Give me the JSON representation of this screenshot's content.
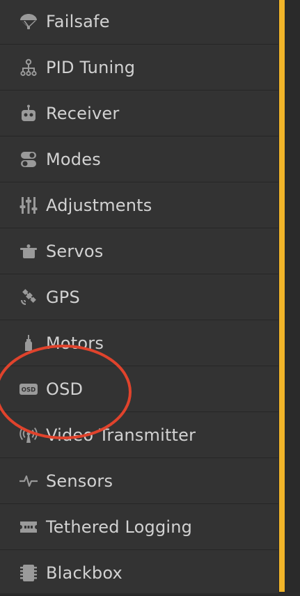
{
  "accent_color": "#f0b429",
  "annotation_color": "#e0432c",
  "sidebar": {
    "items": [
      {
        "label": "Failsafe",
        "icon": "parachute-icon"
      },
      {
        "label": "PID Tuning",
        "icon": "sitemap-icon"
      },
      {
        "label": "Receiver",
        "icon": "robot-icon"
      },
      {
        "label": "Modes",
        "icon": "toggle-icon"
      },
      {
        "label": "Adjustments",
        "icon": "sliders-icon"
      },
      {
        "label": "Servos",
        "icon": "servo-icon"
      },
      {
        "label": "GPS",
        "icon": "satellite-icon"
      },
      {
        "label": "Motors",
        "icon": "motor-icon"
      },
      {
        "label": "OSD",
        "icon": "osd-icon"
      },
      {
        "label": "Video Transmitter",
        "icon": "broadcast-icon"
      },
      {
        "label": "Sensors",
        "icon": "pulse-icon"
      },
      {
        "label": "Tethered Logging",
        "icon": "ticket-icon"
      },
      {
        "label": "Blackbox",
        "icon": "blackbox-icon"
      }
    ]
  }
}
